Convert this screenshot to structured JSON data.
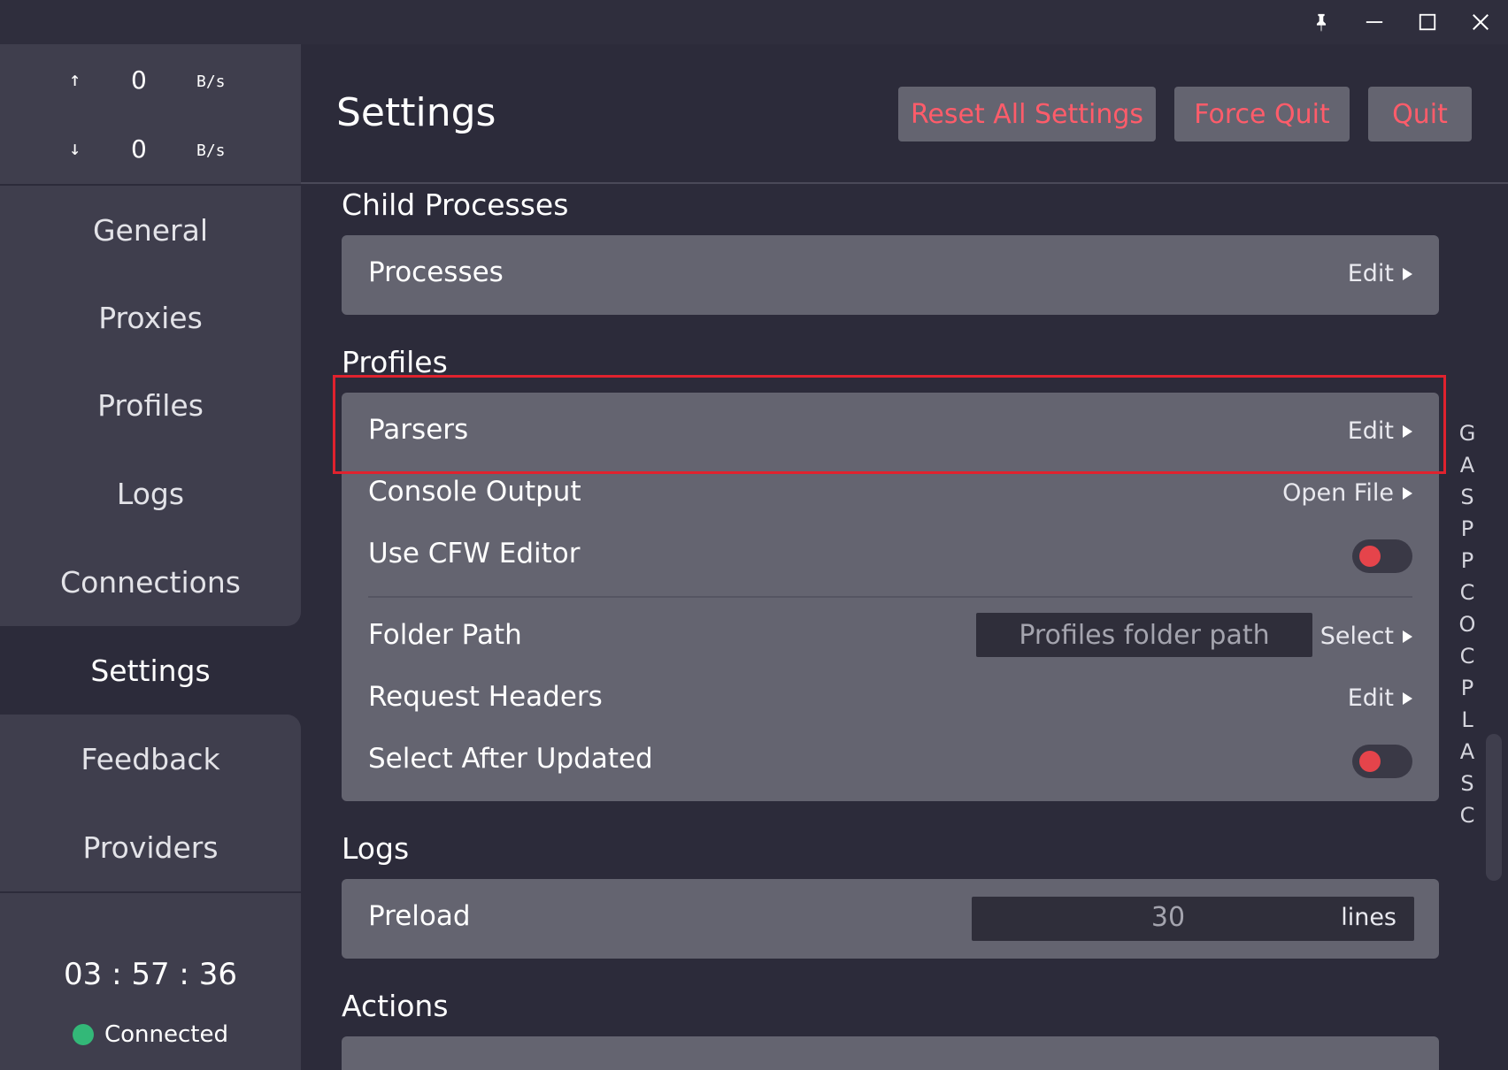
{
  "titlebar": {
    "icons": [
      "pin-icon",
      "minimize-icon",
      "maximize-icon",
      "close-icon"
    ]
  },
  "traffic": {
    "up_arrow": "↑",
    "up_value": "0",
    "up_unit": "B/s",
    "down_arrow": "↓",
    "down_value": "0",
    "down_unit": "B/s"
  },
  "sidebar": {
    "items": [
      "General",
      "Proxies",
      "Profiles",
      "Logs",
      "Connections",
      "Settings",
      "Feedback",
      "Providers"
    ],
    "active": "Settings"
  },
  "status": {
    "time": "03 : 57 : 36",
    "connection": "Connected",
    "connection_color": "#33b878"
  },
  "header": {
    "title": "Settings",
    "reset_all": "Reset All Settings",
    "force_quit": "Force Quit",
    "quit": "Quit"
  },
  "sections": {
    "child_processes": {
      "title": "Child Processes",
      "processes_label": "Processes",
      "processes_action": "Edit"
    },
    "profiles": {
      "title": "Profiles",
      "parsers_label": "Parsers",
      "parsers_action": "Edit",
      "console_output_label": "Console Output",
      "console_output_action": "Open File",
      "use_cfw_editor_label": "Use CFW Editor",
      "use_cfw_editor_on": false,
      "folder_path_label": "Folder Path",
      "folder_path_placeholder": "Profiles folder path",
      "folder_path_action": "Select",
      "request_headers_label": "Request Headers",
      "request_headers_action": "Edit",
      "select_after_updated_label": "Select After Updated",
      "select_after_updated_on": false
    },
    "logs": {
      "title": "Logs",
      "preload_label": "Preload",
      "preload_value": "30",
      "preload_unit": "lines"
    },
    "actions": {
      "title": "Actions"
    }
  },
  "alpha_index": [
    "G",
    "A",
    "S",
    "P",
    "P",
    "C",
    "O",
    "C",
    "P",
    "L",
    "A",
    "S",
    "C"
  ],
  "colors": {
    "accent_red": "#ff5c6a",
    "toggle_off_knob": "#e5444b",
    "highlight": "#e0222e"
  }
}
